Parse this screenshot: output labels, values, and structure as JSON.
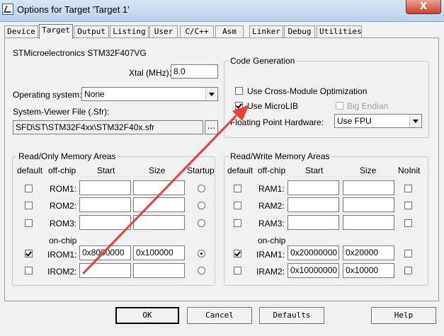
{
  "window": {
    "title": "Options for Target 'Target 1'",
    "close_label": "X"
  },
  "tabs": [
    "Device",
    "Target",
    "Output",
    "Listing",
    "User",
    "C/C++",
    "Asm",
    "Linker",
    "Debug",
    "Utilities"
  ],
  "active_tab": "Target",
  "device": "STMicroelectronics STM32F407VG",
  "xtal": {
    "label": "Xtal (MHz):",
    "value": "8.0"
  },
  "os": {
    "label": "Operating system:",
    "value": "None"
  },
  "svd": {
    "label": "System-Viewer File (.Sfr):",
    "value": "SFD\\ST\\STM32F4xx\\STM32F40x.sfr",
    "browse": "..."
  },
  "codegen": {
    "title": "Code Generation",
    "cross_module": {
      "label": "Use Cross-Module Optimization",
      "checked": false
    },
    "microlib": {
      "label": "Use MicroLIB",
      "checked": true
    },
    "big_endian": {
      "label": "Big Endian",
      "checked": false,
      "disabled": true
    },
    "fph_label": "Floating Point Hardware:",
    "fph_value": "Use FPU"
  },
  "ro_mem": {
    "title": "Read/Only Memory Areas",
    "headers": {
      "default": "default",
      "offchip": "off-chip",
      "start": "Start",
      "size": "Size",
      "startup": "Startup"
    },
    "onchip_label": "on-chip",
    "rows": [
      {
        "label": "ROM1:",
        "start": "",
        "size": "",
        "default": false,
        "startup": false
      },
      {
        "label": "ROM2:",
        "start": "",
        "size": "",
        "default": false,
        "startup": false
      },
      {
        "label": "ROM3:",
        "start": "",
        "size": "",
        "default": false,
        "startup": false
      },
      {
        "label": "IROM1:",
        "start": "0x8000000",
        "size": "0x100000",
        "default": true,
        "startup": true
      },
      {
        "label": "IROM2:",
        "start": "",
        "size": "",
        "default": false,
        "startup": false
      }
    ]
  },
  "rw_mem": {
    "title": "Read/Write Memory Areas",
    "headers": {
      "default": "default",
      "offchip": "off-chip",
      "start": "Start",
      "size": "Size",
      "noinit": "NoInit"
    },
    "onchip_label": "on-chip",
    "rows": [
      {
        "label": "RAM1:",
        "start": "",
        "size": "",
        "default": false,
        "noinit": false
      },
      {
        "label": "RAM2:",
        "start": "",
        "size": "",
        "default": false,
        "noinit": false
      },
      {
        "label": "RAM3:",
        "start": "",
        "size": "",
        "default": false,
        "noinit": false
      },
      {
        "label": "IRAM1:",
        "start": "0x20000000",
        "size": "0x20000",
        "default": true,
        "noinit": false
      },
      {
        "label": "IRAM2:",
        "start": "0x10000000",
        "size": "0x10000",
        "default": false,
        "noinit": false
      }
    ]
  },
  "buttons": {
    "ok": "OK",
    "cancel": "Cancel",
    "defaults": "Defaults",
    "help": "Help"
  },
  "annotation_color": "#e8403a"
}
